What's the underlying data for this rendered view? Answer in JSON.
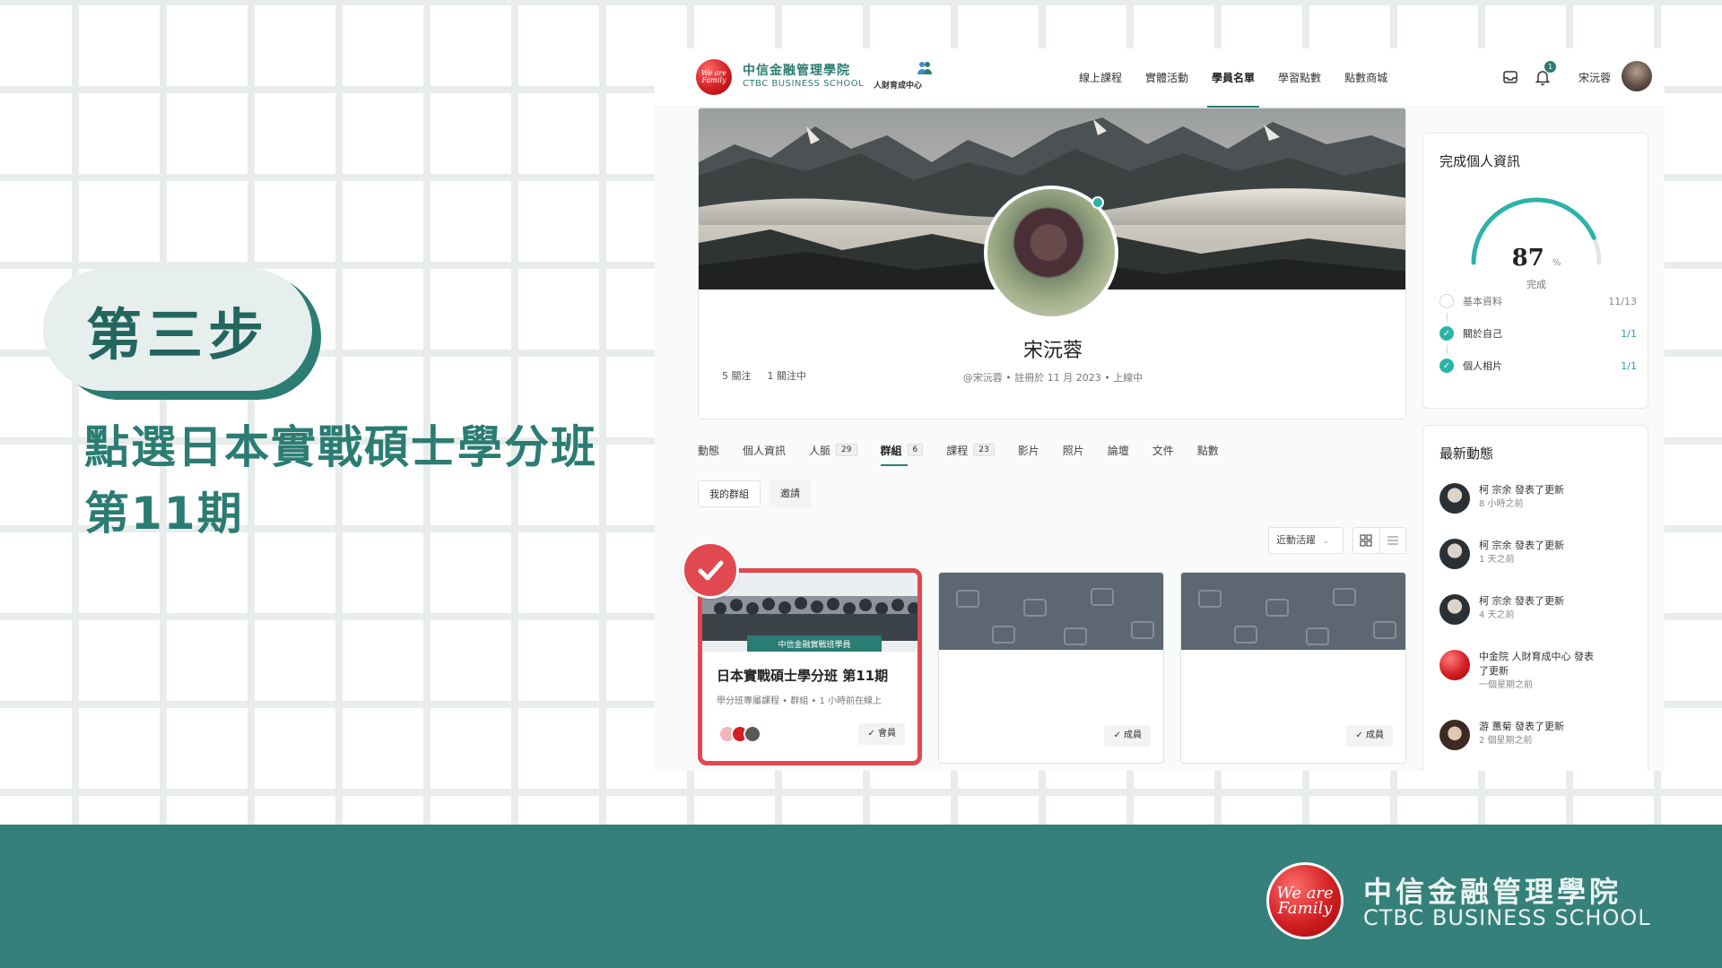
{
  "tutorial": {
    "step_label": "第三步",
    "instruction_line1": "點選日本實戰碩士學分班",
    "instruction_line2": "第11期"
  },
  "footer": {
    "logo_text": "We are Family",
    "name_cn": "中信金融管理學院",
    "name_en": "CTBC BUSINESS SCHOOL"
  },
  "site": {
    "logo_text": "We are Family",
    "name_cn": "中信金融管理學院",
    "name_en": "CTBC BUSINESS SCHOOL",
    "sub_unit": "人財育成中心",
    "nav": [
      "線上課程",
      "實體活動",
      "學員名單",
      "學習點數",
      "點數商城"
    ],
    "nav_active_index": 2,
    "notification_count": "1",
    "user_name": "宋沅蓉",
    "accent_color": "#2b7c72"
  },
  "profile": {
    "name": "宋沅蓉",
    "followers": "5 關注",
    "following": "1 關注中",
    "meta": "@宋沅蓉 • 註冊於 11 月 2023 • 上線中"
  },
  "tabs": [
    {
      "label": "動態",
      "count": ""
    },
    {
      "label": "個人資訊",
      "count": ""
    },
    {
      "label": "人脈",
      "count": "29"
    },
    {
      "label": "群組",
      "count": "6",
      "active": true
    },
    {
      "label": "課程",
      "count": "23"
    },
    {
      "label": "影片",
      "count": ""
    },
    {
      "label": "照片",
      "count": ""
    },
    {
      "label": "論壇",
      "count": ""
    },
    {
      "label": "文件",
      "count": ""
    },
    {
      "label": "點數",
      "count": ""
    }
  ],
  "subtabs": [
    "我的群組",
    "邀請"
  ],
  "sort": {
    "selected": "近動活躍"
  },
  "groups": [
    {
      "title": "日本實戰碩士學分班 第11期",
      "meta": "學分班專屬課程 • 群組 • 1 小時前在線上",
      "banner_text": "中信金融實戰班學員",
      "button": "會員",
      "highlighted": true
    },
    {
      "button": "成員"
    },
    {
      "button": "成員"
    }
  ],
  "completion": {
    "title": "完成個人資訊",
    "percent": "87",
    "percent_unit": "%",
    "caption": "完成",
    "value": 0.87,
    "items": [
      {
        "label": "基本資料",
        "value": "11/13",
        "done": false
      },
      {
        "label": "關於自己",
        "value": "1/1",
        "done": true
      },
      {
        "label": "個人相片",
        "value": "1/1",
        "done": true
      }
    ]
  },
  "activity": {
    "title": "最新動態",
    "items": [
      {
        "text": "柯 宗余 發表了更新",
        "time": "8 小時之前"
      },
      {
        "text": "柯 宗余 發表了更新",
        "time": "1 天之前"
      },
      {
        "text": "柯 宗余 發表了更新",
        "time": "4 天之前"
      },
      {
        "text": "中金院 人財育成中心 發表了更新",
        "time": "一個星期之前"
      },
      {
        "text": "游 蕙菊 發表了更新",
        "time": "2 個星期之前"
      }
    ]
  }
}
